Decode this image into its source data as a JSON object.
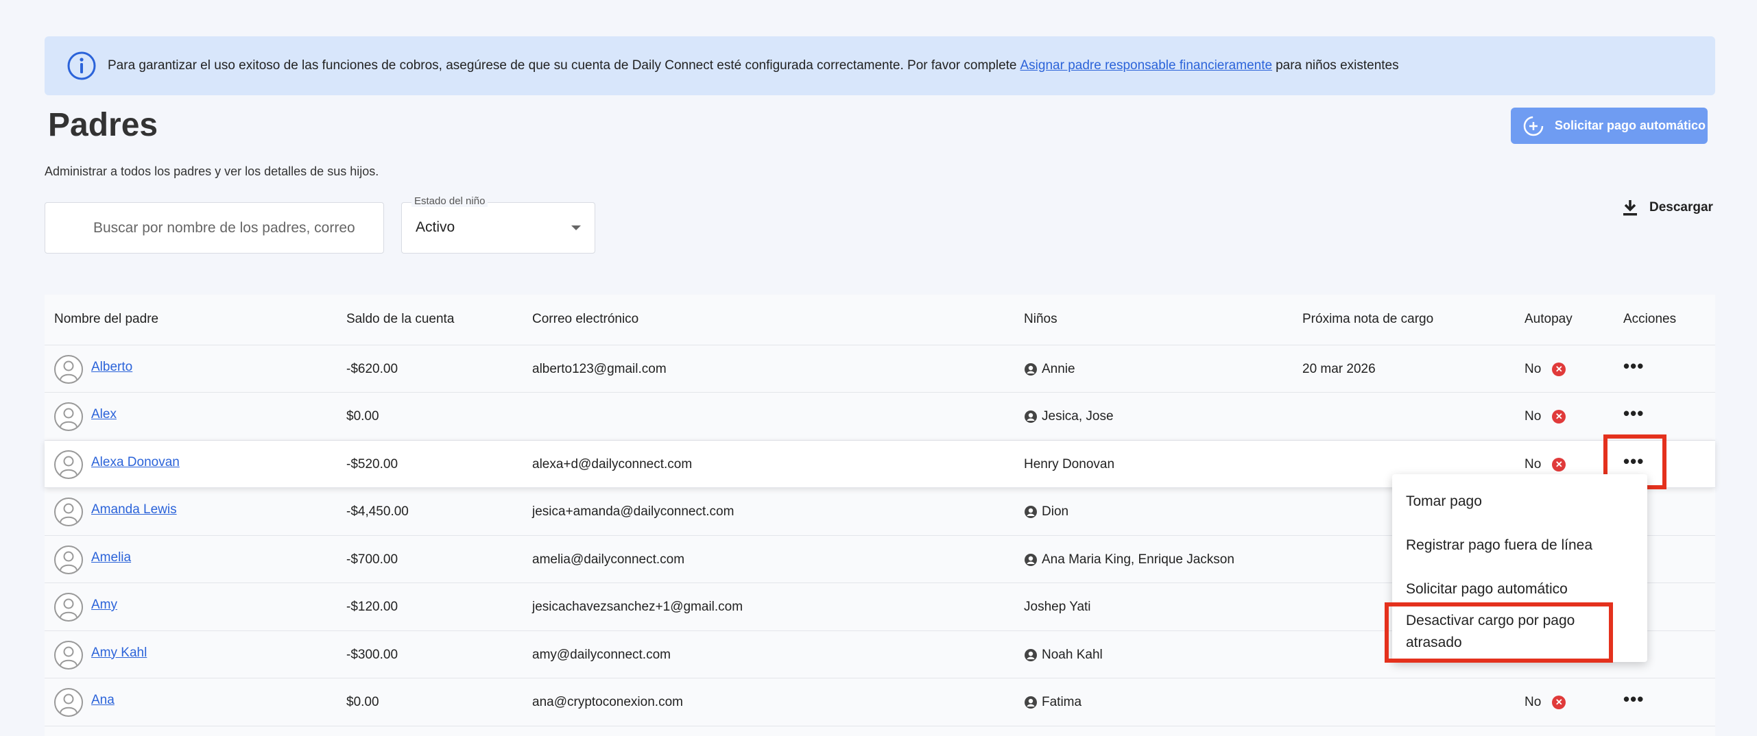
{
  "banner": {
    "text_before": "Para garantizar el uso exitoso de las funciones de cobros, asegúrese de que su cuenta de Daily Connect esté configurada correctamente. Por favor complete",
    "link": "Asignar padre responsable financieramente",
    "text_after": "para niños existentes"
  },
  "page": {
    "title": "Padres",
    "subtitle": "Administrar a todos los padres y ver los detalles de sus hijos.",
    "auto_pay_button": "Solicitar pago automático",
    "download": "Descargar"
  },
  "search": {
    "placeholder": "Buscar por nombre de los padres, correo"
  },
  "child_status": {
    "label": "Estado del niño",
    "value": "Activo"
  },
  "table": {
    "headers": {
      "name": "Nombre del padre",
      "balance": "Saldo de la cuenta",
      "email": "Correo electrónico",
      "kids": "Niños",
      "next_charge": "Próxima nota de cargo",
      "autopay": "Autopay",
      "actions": "Acciones"
    },
    "rows": [
      {
        "name": "Alberto",
        "balance": "-$620.00",
        "email": "alberto123@gmail.com",
        "kids": "Annie",
        "next_charge": "20 mar 2026",
        "autopay": "No",
        "dots": "•••"
      },
      {
        "name": "Alex",
        "balance": "$0.00",
        "email": "",
        "kids": "Jesica, Jose",
        "next_charge": "",
        "autopay": "No",
        "dots": "•••"
      },
      {
        "name": "Alexa Donovan",
        "balance": "-$520.00",
        "email": "alexa+d@dailyconnect.com",
        "kids": "Henry Donovan",
        "next_charge": "",
        "autopay": "No",
        "dots": "•••"
      },
      {
        "name": "Amanda Lewis",
        "balance": "-$4,450.00",
        "email": "jesica+amanda@dailyconnect.com",
        "kids": "Dion",
        "next_charge": "",
        "autopay": "",
        "dots": ""
      },
      {
        "name": "Amelia",
        "balance": "-$700.00",
        "email": "amelia@dailyconnect.com",
        "kids": "Ana Maria King, Enrique Jackson",
        "next_charge": "",
        "autopay": "",
        "dots": ""
      },
      {
        "name": "Amy",
        "balance": "-$120.00",
        "email": "jesicachavezsanchez+1@gmail.com",
        "kids": "Joshep Yati",
        "next_charge": "",
        "autopay": "",
        "dots": ""
      },
      {
        "name": "Amy Kahl",
        "balance": "-$300.00",
        "email": "amy@dailyconnect.com",
        "kids": "Noah Kahl",
        "next_charge": "",
        "autopay": "",
        "dots": ""
      },
      {
        "name": "Ana",
        "balance": "$0.00",
        "email": "ana@cryptoconexion.com",
        "kids": "Fatima",
        "next_charge": "",
        "autopay": "No",
        "dots": "•••"
      }
    ]
  },
  "menu": {
    "take_payment": "Tomar pago",
    "offline_payment": "Registrar pago fuera de línea",
    "request_autopay": "Solicitar pago automático",
    "disable_late_fee": "Desactivar cargo por pago atrasado"
  },
  "colors": {
    "accent": "#2b63d9",
    "button": "#6f9cf2",
    "highlight_box": "#e4311d",
    "banner": "#d8e6fb"
  }
}
